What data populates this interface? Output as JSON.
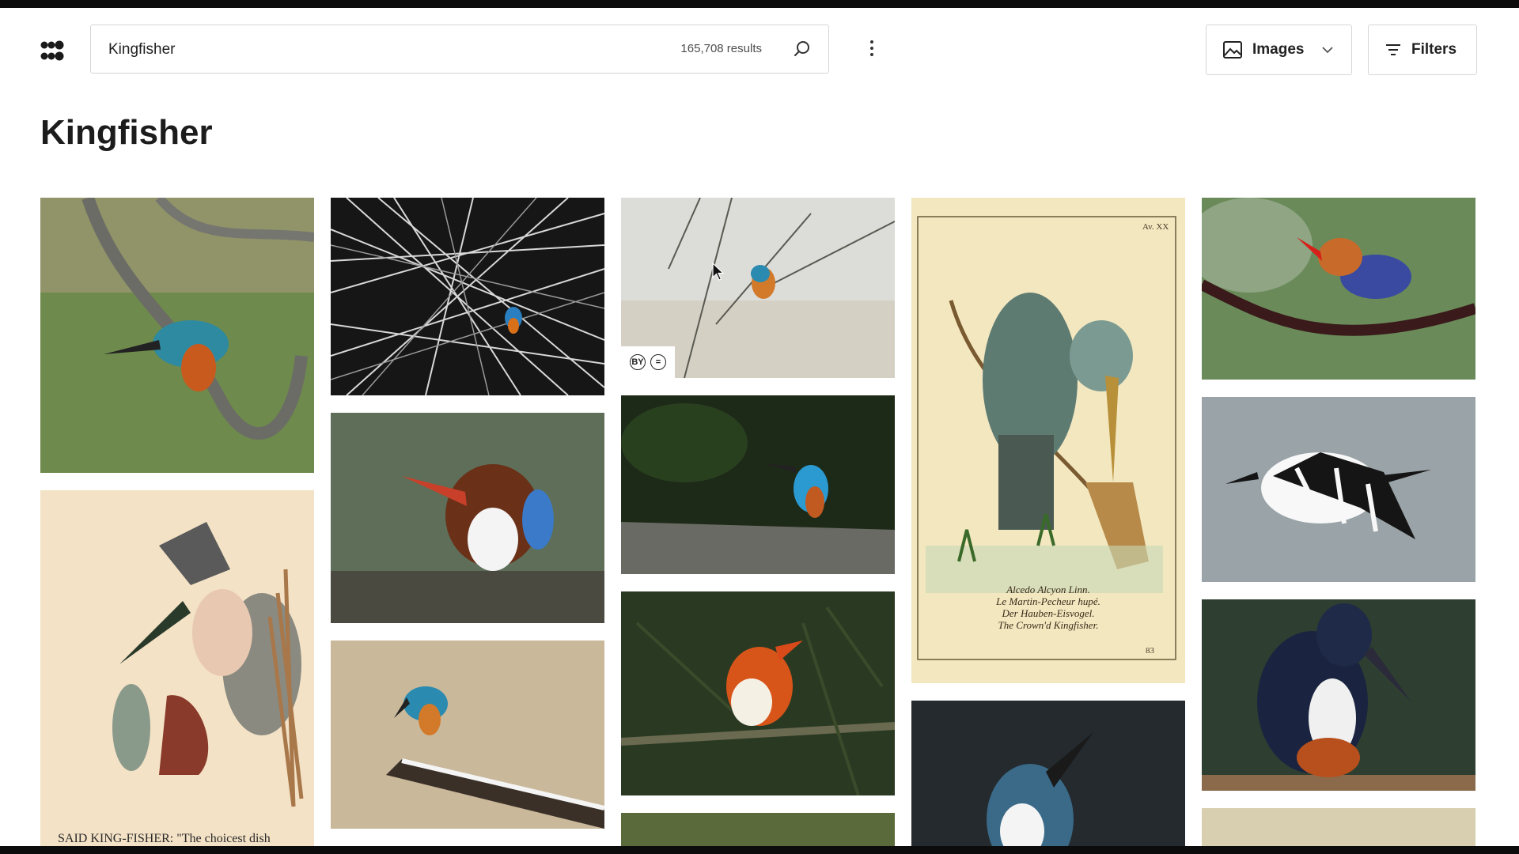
{
  "app": {
    "logo_icon": "openverse-logo-icon"
  },
  "search": {
    "value": "Kingfisher",
    "results": "165,708 results",
    "search_icon": "search-icon"
  },
  "header": {
    "more_icon": "more-vertical-icon",
    "content_type": {
      "label": "Images",
      "icon": "image-icon",
      "chevron": "chevron-down-icon"
    },
    "filters": {
      "label": "Filters",
      "icon": "filter-lines-icon"
    }
  },
  "page": {
    "title": "Kingfisher"
  },
  "results_grid": {
    "license_badges": [
      "BY",
      "="
    ],
    "tiles": [
      {
        "subject": "common kingfisher on curved branch",
        "colors": [
          "#4f7a3c",
          "#2e8aa0",
          "#c85a1e"
        ]
      },
      {
        "subject": "kingfisher among black-and-white twigs",
        "colors": [
          "#1a1a1a",
          "#e0e0e0",
          "#2a7fc0"
        ]
      },
      {
        "subject": "kingfisher on thin twig, pale background",
        "colors": [
          "#d8d8d4",
          "#2a8ab0",
          "#d27a2a"
        ]
      },
      {
        "subject": "vintage engraving of crowned kingfisher",
        "colors": [
          "#f3e7bf",
          "#5e7b72",
          "#8a6a3a"
        ]
      },
      {
        "subject": "stork-billed kingfisher on branch",
        "colors": [
          "#6a8a5a",
          "#3a4aa0",
          "#d8501a"
        ]
      },
      {
        "subject": "white-throated kingfisher",
        "colors": [
          "#5a6a58",
          "#7a3a1a",
          "#ffffff"
        ]
      },
      {
        "subject": "common kingfisher on log, dark background",
        "colors": [
          "#1e2a18",
          "#2a9ad0",
          "#c05a20"
        ]
      },
      {
        "subject": "pied kingfisher in flight",
        "colors": [
          "#9aa3a7",
          "#111111",
          "#ffffff"
        ]
      },
      {
        "subject": "vintage illustration: kingfisher and frog",
        "colors": [
          "#f3e2c6",
          "#3a3a3a",
          "#a85a3a"
        ]
      },
      {
        "subject": "kingfisher on snowy branch",
        "colors": [
          "#bfae94",
          "#2a8ab0",
          "#d27a2a"
        ]
      },
      {
        "subject": "rufous-backed dwarf kingfisher",
        "colors": [
          "#2a3a22",
          "#d8551a",
          "#ffffff"
        ]
      },
      {
        "subject": "giant kingfisher",
        "colors": [
          "#2e3e30",
          "#1a2440",
          "#b8501e"
        ]
      },
      {
        "subject": "kingfisher close-up",
        "colors": [
          "#242a2e",
          "#3a6a88",
          "#ffffff"
        ]
      },
      {
        "subject": "partially visible photo",
        "colors": [
          "#5a6a3a"
        ]
      },
      {
        "subject": "partially visible engraving",
        "colors": [
          "#d8cfb0"
        ]
      }
    ],
    "vintage_caption": "SAID KING-FISHER: \"The choicest dish",
    "engraving_caption": {
      "plate": "Av. XX",
      "lines": [
        "Alcedo Alcyon Linn.",
        "Le Martin-Pecheur hupé.",
        "Der Hauben-Eisvogel.",
        "The Crown'd Kingfisher."
      ],
      "page": "83"
    }
  }
}
